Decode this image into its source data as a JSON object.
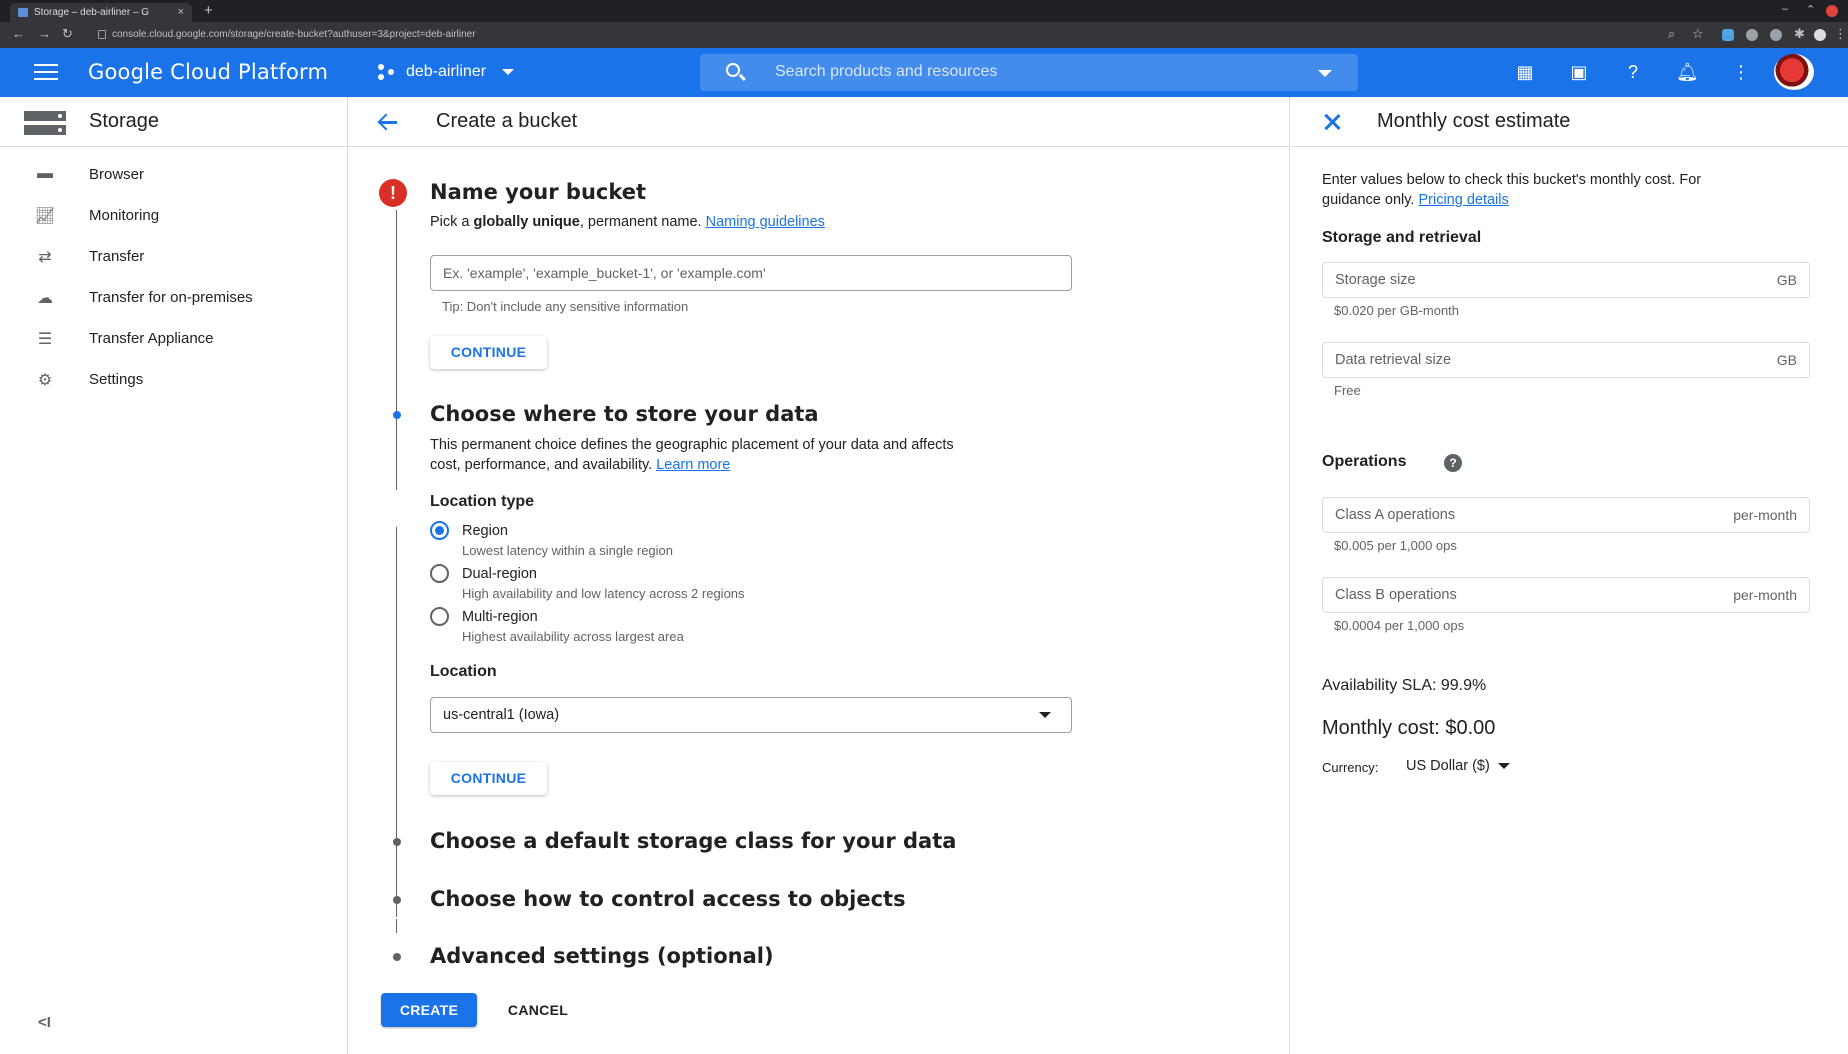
{
  "browser": {
    "tab_title": "Storage – deb-airliner – G",
    "tab_close": "×",
    "new_tab": "+",
    "url": "console.cloud.google.com/storage/create-bucket?authuser=3&project=deb-airliner"
  },
  "header": {
    "brand": "Google Cloud Platform",
    "project": "deb-airliner",
    "search_placeholder": "Search products and resources"
  },
  "sidebar": {
    "title": "Storage",
    "items": [
      {
        "label": "Browser",
        "icon": "bucket-icon"
      },
      {
        "label": "Monitoring",
        "icon": "chart-icon"
      },
      {
        "label": "Transfer",
        "icon": "transfer-icon"
      },
      {
        "label": "Transfer for on-premises",
        "icon": "cloud-upload-icon"
      },
      {
        "label": "Transfer Appliance",
        "icon": "list-icon"
      },
      {
        "label": "Settings",
        "icon": "gear-icon"
      }
    ],
    "collapse": "<I"
  },
  "main": {
    "title": "Create a bucket",
    "step1": {
      "title": "Name your bucket",
      "desc_prefix": "Pick a ",
      "desc_bold": "globally unique",
      "desc_suffix": ", permanent name. ",
      "link": "Naming guidelines",
      "placeholder": "Ex. 'example', 'example_bucket-1', or 'example.com'",
      "tip": "Tip: Don't include any sensitive information",
      "continue": "CONTINUE"
    },
    "step2": {
      "title": "Choose where to store your data",
      "desc_line1": "This permanent choice defines the geographic placement of your data and affects",
      "desc_line2": "cost, performance, and availability. ",
      "link": "Learn more",
      "location_type_label": "Location type",
      "options": [
        {
          "label": "Region",
          "desc": "Lowest latency within a single region",
          "checked": true
        },
        {
          "label": "Dual-region",
          "desc": "High availability and low latency across 2 regions",
          "checked": false
        },
        {
          "label": "Multi-region",
          "desc": "Highest availability across largest area",
          "checked": false
        }
      ],
      "location_label": "Location",
      "location_value": "us-central1 (Iowa)",
      "continue": "CONTINUE"
    },
    "step3_title": "Choose a default storage class for your data",
    "step4_title": "Choose how to control access to objects",
    "step5_title": "Advanced settings (optional)",
    "create": "CREATE",
    "cancel": "CANCEL"
  },
  "panel": {
    "title": "Monthly cost estimate",
    "intro_line1": "Enter values below to check this bucket's monthly cost. For",
    "intro_line2": "guidance only. ",
    "intro_link": "Pricing details",
    "storage_heading": "Storage and retrieval",
    "storage_size": {
      "label": "Storage size",
      "unit": "GB",
      "hint": "$0.020 per GB-month"
    },
    "retrieval_size": {
      "label": "Data retrieval size",
      "unit": "GB",
      "hint": "Free"
    },
    "operations_heading": "Operations",
    "class_a": {
      "label": "Class A operations",
      "unit": "per-month",
      "hint": "$0.005 per 1,000 ops"
    },
    "class_b": {
      "label": "Class B operations",
      "unit": "per-month",
      "hint": "$0.0004 per 1,000 ops"
    },
    "sla": "Availability SLA: 99.9%",
    "monthly_cost": "Monthly cost: $0.00",
    "currency_label": "Currency:",
    "currency_value": "US Dollar ($)"
  },
  "colors": {
    "brand_blue": "#1a73e8",
    "error_red": "#d93025"
  }
}
